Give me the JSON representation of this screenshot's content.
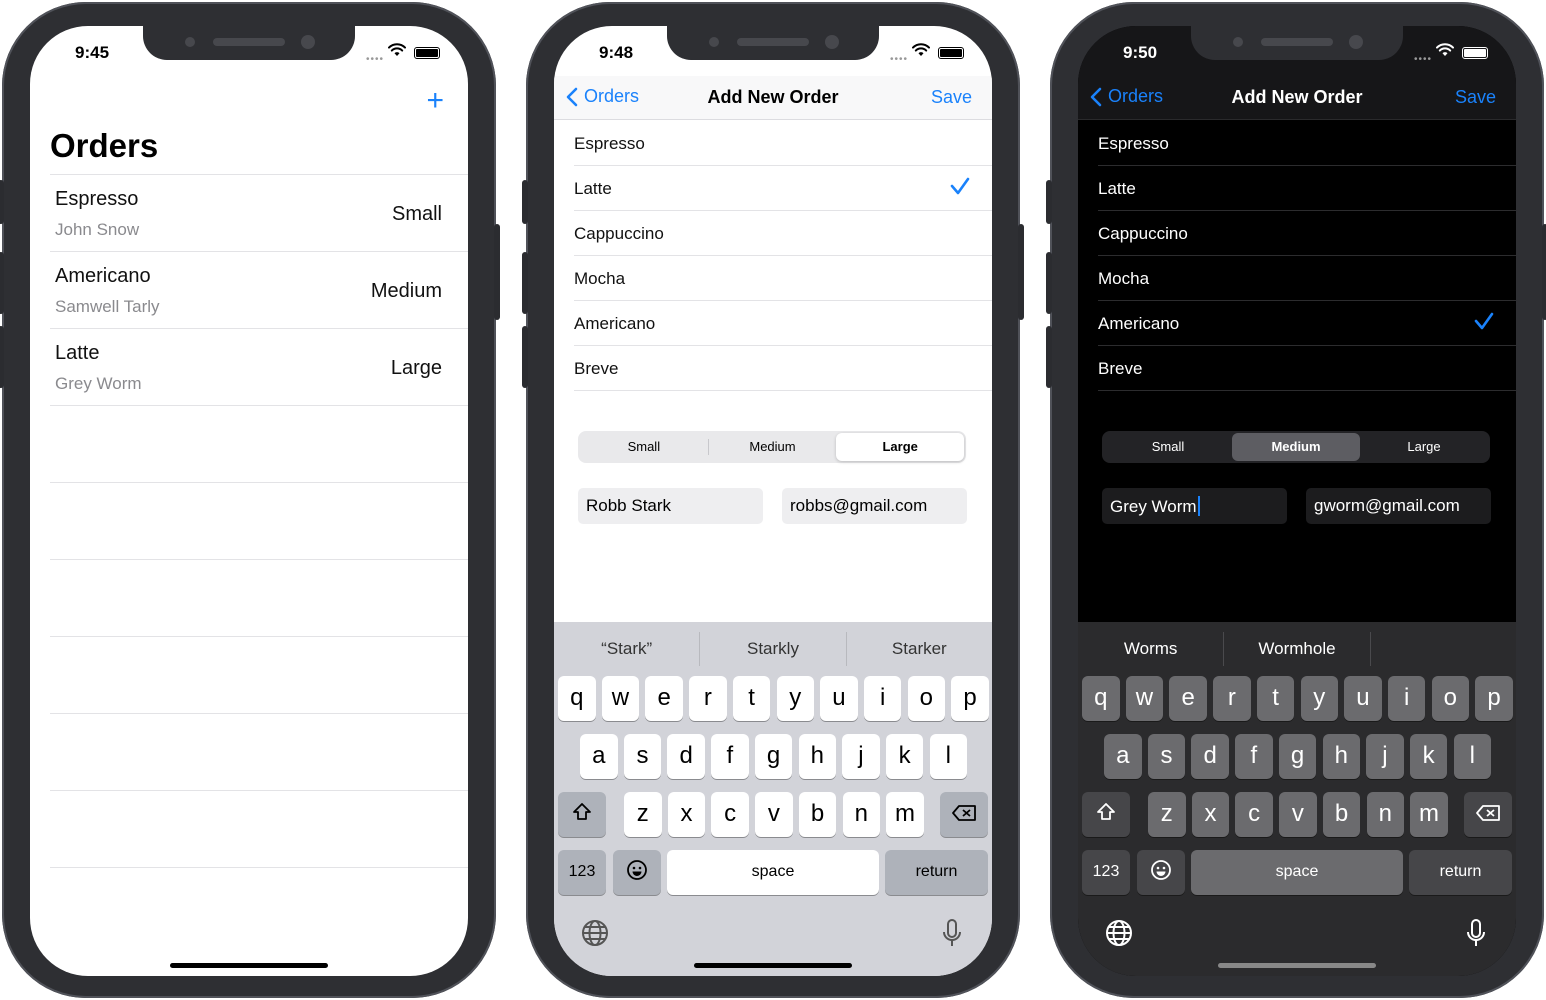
{
  "screen1": {
    "time": "9:45",
    "add_icon": "+",
    "title": "Orders",
    "orders": [
      {
        "coffee": "Espresso",
        "customer": "John Snow",
        "size": "Small"
      },
      {
        "coffee": "Americano",
        "customer": "Samwell Tarly",
        "size": "Medium"
      },
      {
        "coffee": "Latte",
        "customer": "Grey Worm",
        "size": "Large"
      }
    ]
  },
  "screen2": {
    "time": "9:48",
    "nav": {
      "back": "Orders",
      "title": "Add New Order",
      "save": "Save"
    },
    "coffees": [
      "Espresso",
      "Latte",
      "Cappuccino",
      "Mocha",
      "Americano",
      "Breve"
    ],
    "checked_index": 1,
    "sizes": [
      "Small",
      "Medium",
      "Large"
    ],
    "selected_size": "Large",
    "name_value": "Robb Stark",
    "email_value": "robbs@gmail.com",
    "suggestions": [
      "“Stark”",
      "Starkly",
      "Starker"
    ]
  },
  "screen3": {
    "time": "9:50",
    "nav": {
      "back": "Orders",
      "title": "Add New Order",
      "save": "Save"
    },
    "coffees": [
      "Espresso",
      "Latte",
      "Cappuccino",
      "Mocha",
      "Americano",
      "Breve"
    ],
    "checked_index": 4,
    "sizes": [
      "Small",
      "Medium",
      "Large"
    ],
    "selected_size": "Medium",
    "name_value": "Grey Worm",
    "email_value": "gworm@gmail.com",
    "suggestions": [
      "Worms",
      "Wormhole",
      ""
    ]
  },
  "keyboard": {
    "row1": [
      "q",
      "w",
      "e",
      "r",
      "t",
      "y",
      "u",
      "i",
      "o",
      "p"
    ],
    "row2": [
      "a",
      "s",
      "d",
      "f",
      "g",
      "h",
      "j",
      "k",
      "l"
    ],
    "row3": [
      "z",
      "x",
      "c",
      "v",
      "b",
      "n",
      "m"
    ],
    "numbers_label": "123",
    "space_label": "space",
    "return_label": "return"
  },
  "colors": {
    "accent": "#1a82fb",
    "dark_bg": "#000000",
    "light_kb": "#d2d3d9",
    "dark_kb": "#2b2b2d"
  }
}
